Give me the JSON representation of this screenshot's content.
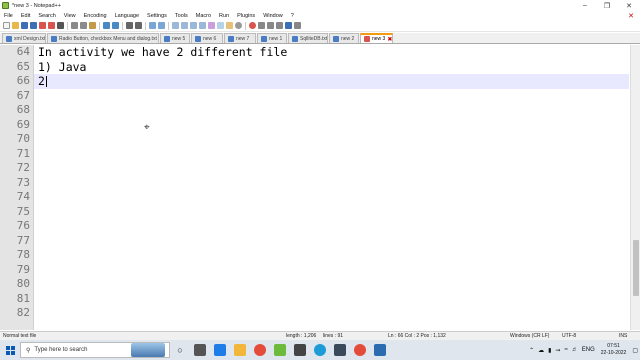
{
  "window": {
    "title": "*new 3 - Notepad++"
  },
  "menu": [
    "File",
    "Edit",
    "Search",
    "View",
    "Encoding",
    "Language",
    "Settings",
    "Tools",
    "Macro",
    "Run",
    "Plugins",
    "Window",
    "?"
  ],
  "tabs": [
    {
      "label": "xml Design.txt",
      "active": false
    },
    {
      "label": "Radio Button, checkbox Menu and dialog.txt",
      "active": false
    },
    {
      "label": "new 5",
      "active": false
    },
    {
      "label": "new 6",
      "active": false
    },
    {
      "label": "new 7",
      "active": false
    },
    {
      "label": "new 1",
      "active": false
    },
    {
      "label": "SqlliteDB.txt",
      "active": false
    },
    {
      "label": "new 2",
      "active": false
    },
    {
      "label": "new 3",
      "active": true
    }
  ],
  "editor": {
    "lines": [
      {
        "num": "64",
        "text": "In activity we have 2 different file"
      },
      {
        "num": "65",
        "text": "1) Java"
      },
      {
        "num": "66",
        "text": "2"
      },
      {
        "num": "67",
        "text": ""
      },
      {
        "num": "68",
        "text": ""
      },
      {
        "num": "69",
        "text": ""
      },
      {
        "num": "70",
        "text": ""
      },
      {
        "num": "71",
        "text": ""
      },
      {
        "num": "72",
        "text": ""
      },
      {
        "num": "73",
        "text": ""
      },
      {
        "num": "74",
        "text": ""
      },
      {
        "num": "75",
        "text": ""
      },
      {
        "num": "76",
        "text": ""
      },
      {
        "num": "77",
        "text": ""
      },
      {
        "num": "78",
        "text": ""
      },
      {
        "num": "79",
        "text": ""
      },
      {
        "num": "80",
        "text": ""
      },
      {
        "num": "81",
        "text": ""
      },
      {
        "num": "82",
        "text": ""
      }
    ]
  },
  "status": {
    "filetype": "Normal text file",
    "length": "length : 1,206",
    "lines": "lines : 91",
    "position": "Ln : 66   Col : 2   Pos : 1,132",
    "eol": "Windows (CR LF)",
    "encoding": "UTF-8",
    "mode": "INS"
  },
  "taskbar": {
    "search_placeholder": "Type here to search",
    "language": "ENG",
    "time": "07:51",
    "date": "22-10-2022"
  }
}
